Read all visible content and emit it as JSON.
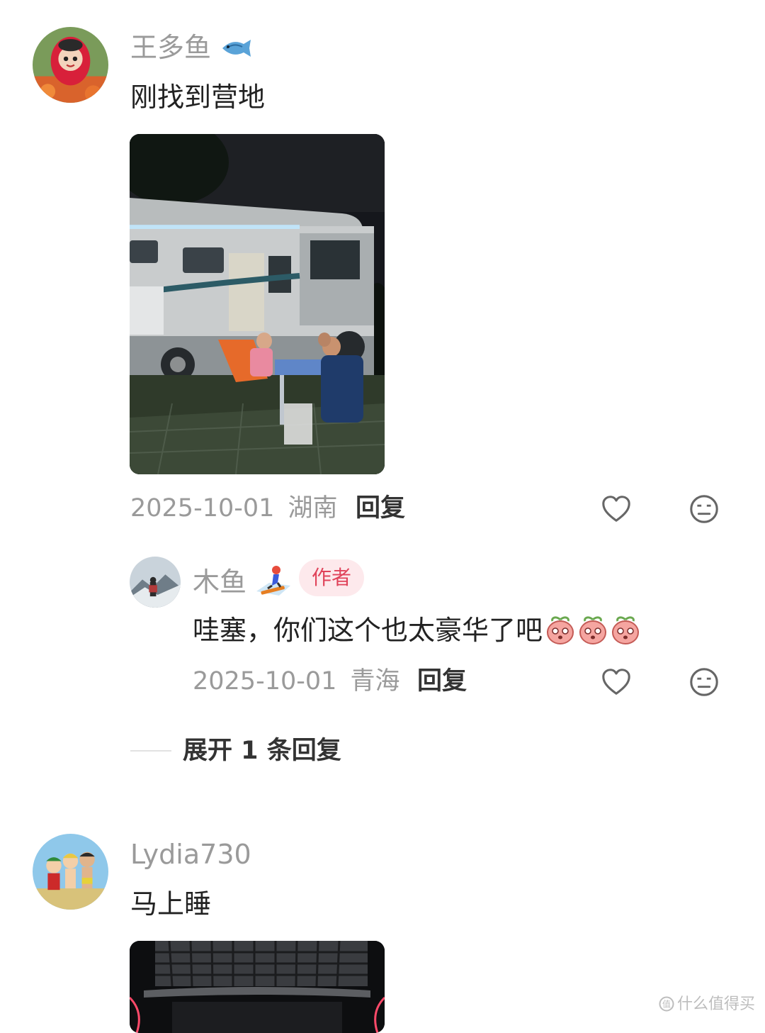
{
  "comments": [
    {
      "username": "王多鱼",
      "username_emoji": "fish-icon",
      "text": "刚找到营地",
      "date": "2025-10-01",
      "location": "湖南",
      "reply_label": "回复",
      "image": "camper-van-night-photo"
    },
    {
      "username": "Lydia730",
      "text": "马上睡",
      "image": "camper-interior-photo"
    }
  ],
  "reply": {
    "username": "木鱼",
    "username_emoji": "snowboarder-icon",
    "badge": "作者",
    "text": "哇塞，你们这个也太豪华了吧",
    "text_emojis": [
      "peach-emoji",
      "peach-emoji",
      "peach-emoji"
    ],
    "date": "2025-10-01",
    "location": "青海",
    "reply_label": "回复"
  },
  "expand_replies": "展开 1 条回复",
  "watermark": "什么值得买",
  "colors": {
    "badge_bg": "#fde9ec",
    "badge_text": "#e0435a",
    "meta_gray": "#9a9a9a"
  }
}
